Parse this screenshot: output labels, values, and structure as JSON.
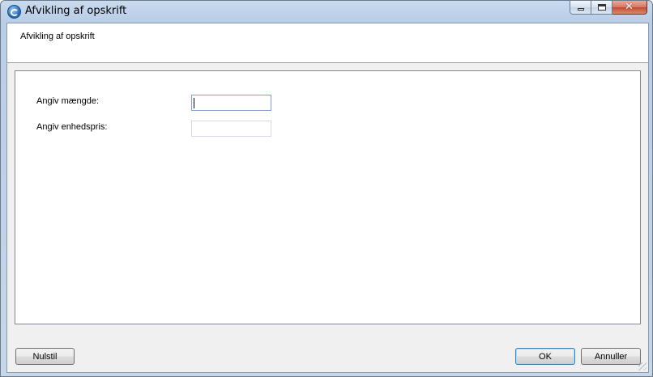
{
  "window": {
    "title": "Afvikling af opskrift",
    "app_icon": "app-logo-icon",
    "caption_buttons": [
      "minimize",
      "maximize",
      "close"
    ]
  },
  "header": {
    "title": "Afvikling af opskrift"
  },
  "form": {
    "quantity_label": "Angiv mængde:",
    "quantity_value": "",
    "unit_price_label": "Angiv enhedspris:",
    "unit_price_value": ""
  },
  "buttons": {
    "reset_label": "Nulstil",
    "ok_label": "OK",
    "cancel_label": "Annuller"
  }
}
